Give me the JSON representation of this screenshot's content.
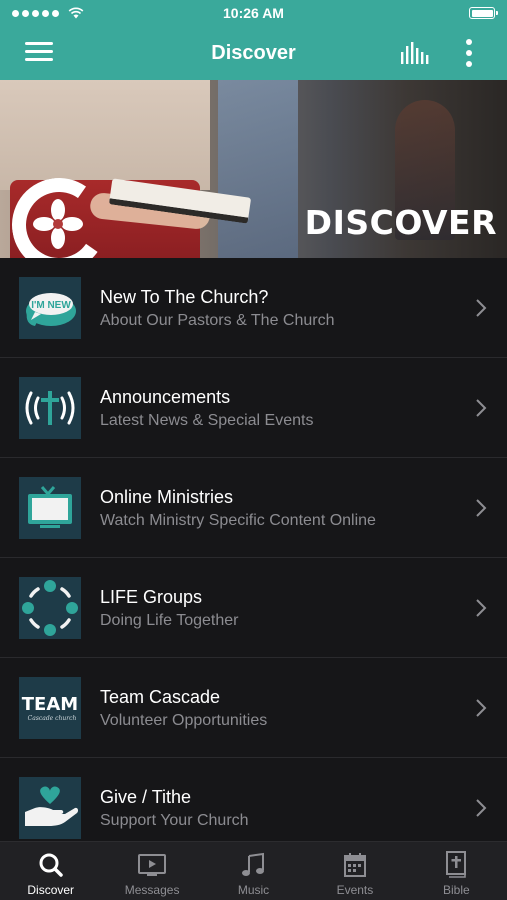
{
  "status_bar": {
    "time": "10:26 AM"
  },
  "nav": {
    "title": "Discover"
  },
  "hero": {
    "text": "DISCOVER"
  },
  "colors": {
    "accent": "#3aa99b",
    "background": "#161618",
    "icon_tile": "#1e3b48",
    "subtitle": "#8c8c91",
    "tab_inactive": "#8e8e93"
  },
  "list": {
    "items": [
      {
        "title": "New To The Church?",
        "subtitle": "About Our Pastors & The Church",
        "icon": "im-new-speech-bubble-icon",
        "icon_text": "I'M NEW"
      },
      {
        "title": "Announcements",
        "subtitle": "Latest News & Special Events",
        "icon": "broadcast-cross-icon"
      },
      {
        "title": "Online Ministries",
        "subtitle": "Watch Ministry Specific Content Online",
        "icon": "tv-icon"
      },
      {
        "title": "LIFE Groups",
        "subtitle": "Doing Life Together",
        "icon": "circle-of-people-icon"
      },
      {
        "title": "Team Cascade",
        "subtitle": "Volunteer Opportunities",
        "icon": "team-logo-icon",
        "icon_text": "TEAM",
        "icon_subtext": "Cascade church"
      },
      {
        "title": "Give / Tithe",
        "subtitle": "Support Your Church",
        "icon": "heart-in-hand-icon"
      }
    ]
  },
  "tabs": [
    {
      "label": "Discover",
      "icon": "search-icon",
      "active": true
    },
    {
      "label": "Messages",
      "icon": "video-icon",
      "active": false
    },
    {
      "label": "Music",
      "icon": "music-note-icon",
      "active": false
    },
    {
      "label": "Events",
      "icon": "calendar-icon",
      "active": false
    },
    {
      "label": "Bible",
      "icon": "bible-icon",
      "active": false
    }
  ]
}
